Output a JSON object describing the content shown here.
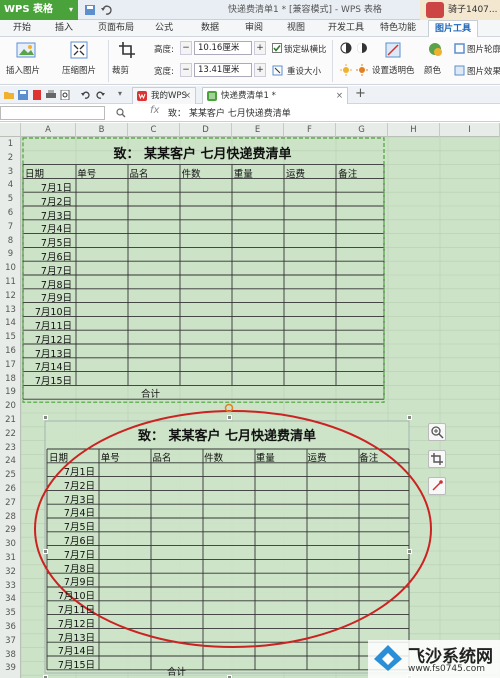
{
  "app": {
    "name": "WPS 表格",
    "window_title": "快递费清单1 * [兼容模式] - WPS 表格",
    "user_name": "骑子1407..."
  },
  "menu_tabs": [
    "开始",
    "插入",
    "页面布局",
    "公式",
    "数据",
    "审阅",
    "视图",
    "开发工具",
    "特色功能",
    "图片工具"
  ],
  "active_menu_tab": "图片工具",
  "ribbon": {
    "insert_picture": "插入图片",
    "compress_picture": "压缩图片",
    "crop": "裁剪",
    "height_label": "高度:",
    "height_value": "10.16厘米",
    "width_label": "宽度:",
    "width_value": "13.41厘米",
    "lock_ratio": "锁定纵横比",
    "reset_size": "重设大小",
    "set_transparent": "设置透明色",
    "color": "颜色",
    "picture_outline": "图片轮廓",
    "picture_effect": "图片效果"
  },
  "doc_tabs": [
    {
      "label": "我的WPS",
      "active": false
    },
    {
      "label": "快递费清单1 *",
      "active": true
    }
  ],
  "formula_bar": {
    "fx": "fx",
    "content": "致：  某某客户    七月快递费清单"
  },
  "columns": [
    "A",
    "B",
    "C",
    "D",
    "E",
    "F",
    "G",
    "H",
    "I"
  ],
  "rows": [
    "1",
    "2",
    "3",
    "4",
    "5",
    "6",
    "7",
    "8",
    "9",
    "10",
    "11",
    "12",
    "13",
    "14",
    "15",
    "16",
    "17",
    "18",
    "19",
    "20",
    "21",
    "22",
    "23",
    "24",
    "25",
    "26",
    "27",
    "28",
    "29",
    "30",
    "31",
    "32",
    "33",
    "34",
    "35",
    "36",
    "37",
    "38",
    "39"
  ],
  "sheet_table": {
    "title": "致：  某某客户    七月快递费清单",
    "headers": [
      "日期",
      "单号",
      "品名",
      "件数",
      "重量",
      "运费",
      "备注"
    ],
    "dates": [
      "7月1日",
      "7月2日",
      "7月3日",
      "7月4日",
      "7月5日",
      "7月6日",
      "7月7日",
      "7月8日",
      "7月9日",
      "7月10日",
      "7月11日",
      "7月12日",
      "7月13日",
      "7月14日",
      "7月15日"
    ],
    "total_label": "合计"
  },
  "picture_table": {
    "title": "致：  某某客户    七月快递费清单",
    "headers": [
      "日期",
      "单号",
      "品名",
      "件数",
      "重量",
      "运费",
      "备注"
    ],
    "dates": [
      "7月1日",
      "7月2日",
      "7月3日",
      "7月4日",
      "7月5日",
      "7月6日",
      "7月7日",
      "7月8日",
      "7月9日",
      "7月10日",
      "7月11日",
      "7月12日",
      "7月13日",
      "7月14日",
      "7月15日"
    ],
    "total_label": "合计"
  },
  "watermark": {
    "name": "飞沙系统网",
    "url": "www.fs0745.com"
  },
  "colors": {
    "accent_green": "#4aa23a",
    "sheet_bg": "#cde3c8",
    "annotation_red": "#cc2222"
  }
}
